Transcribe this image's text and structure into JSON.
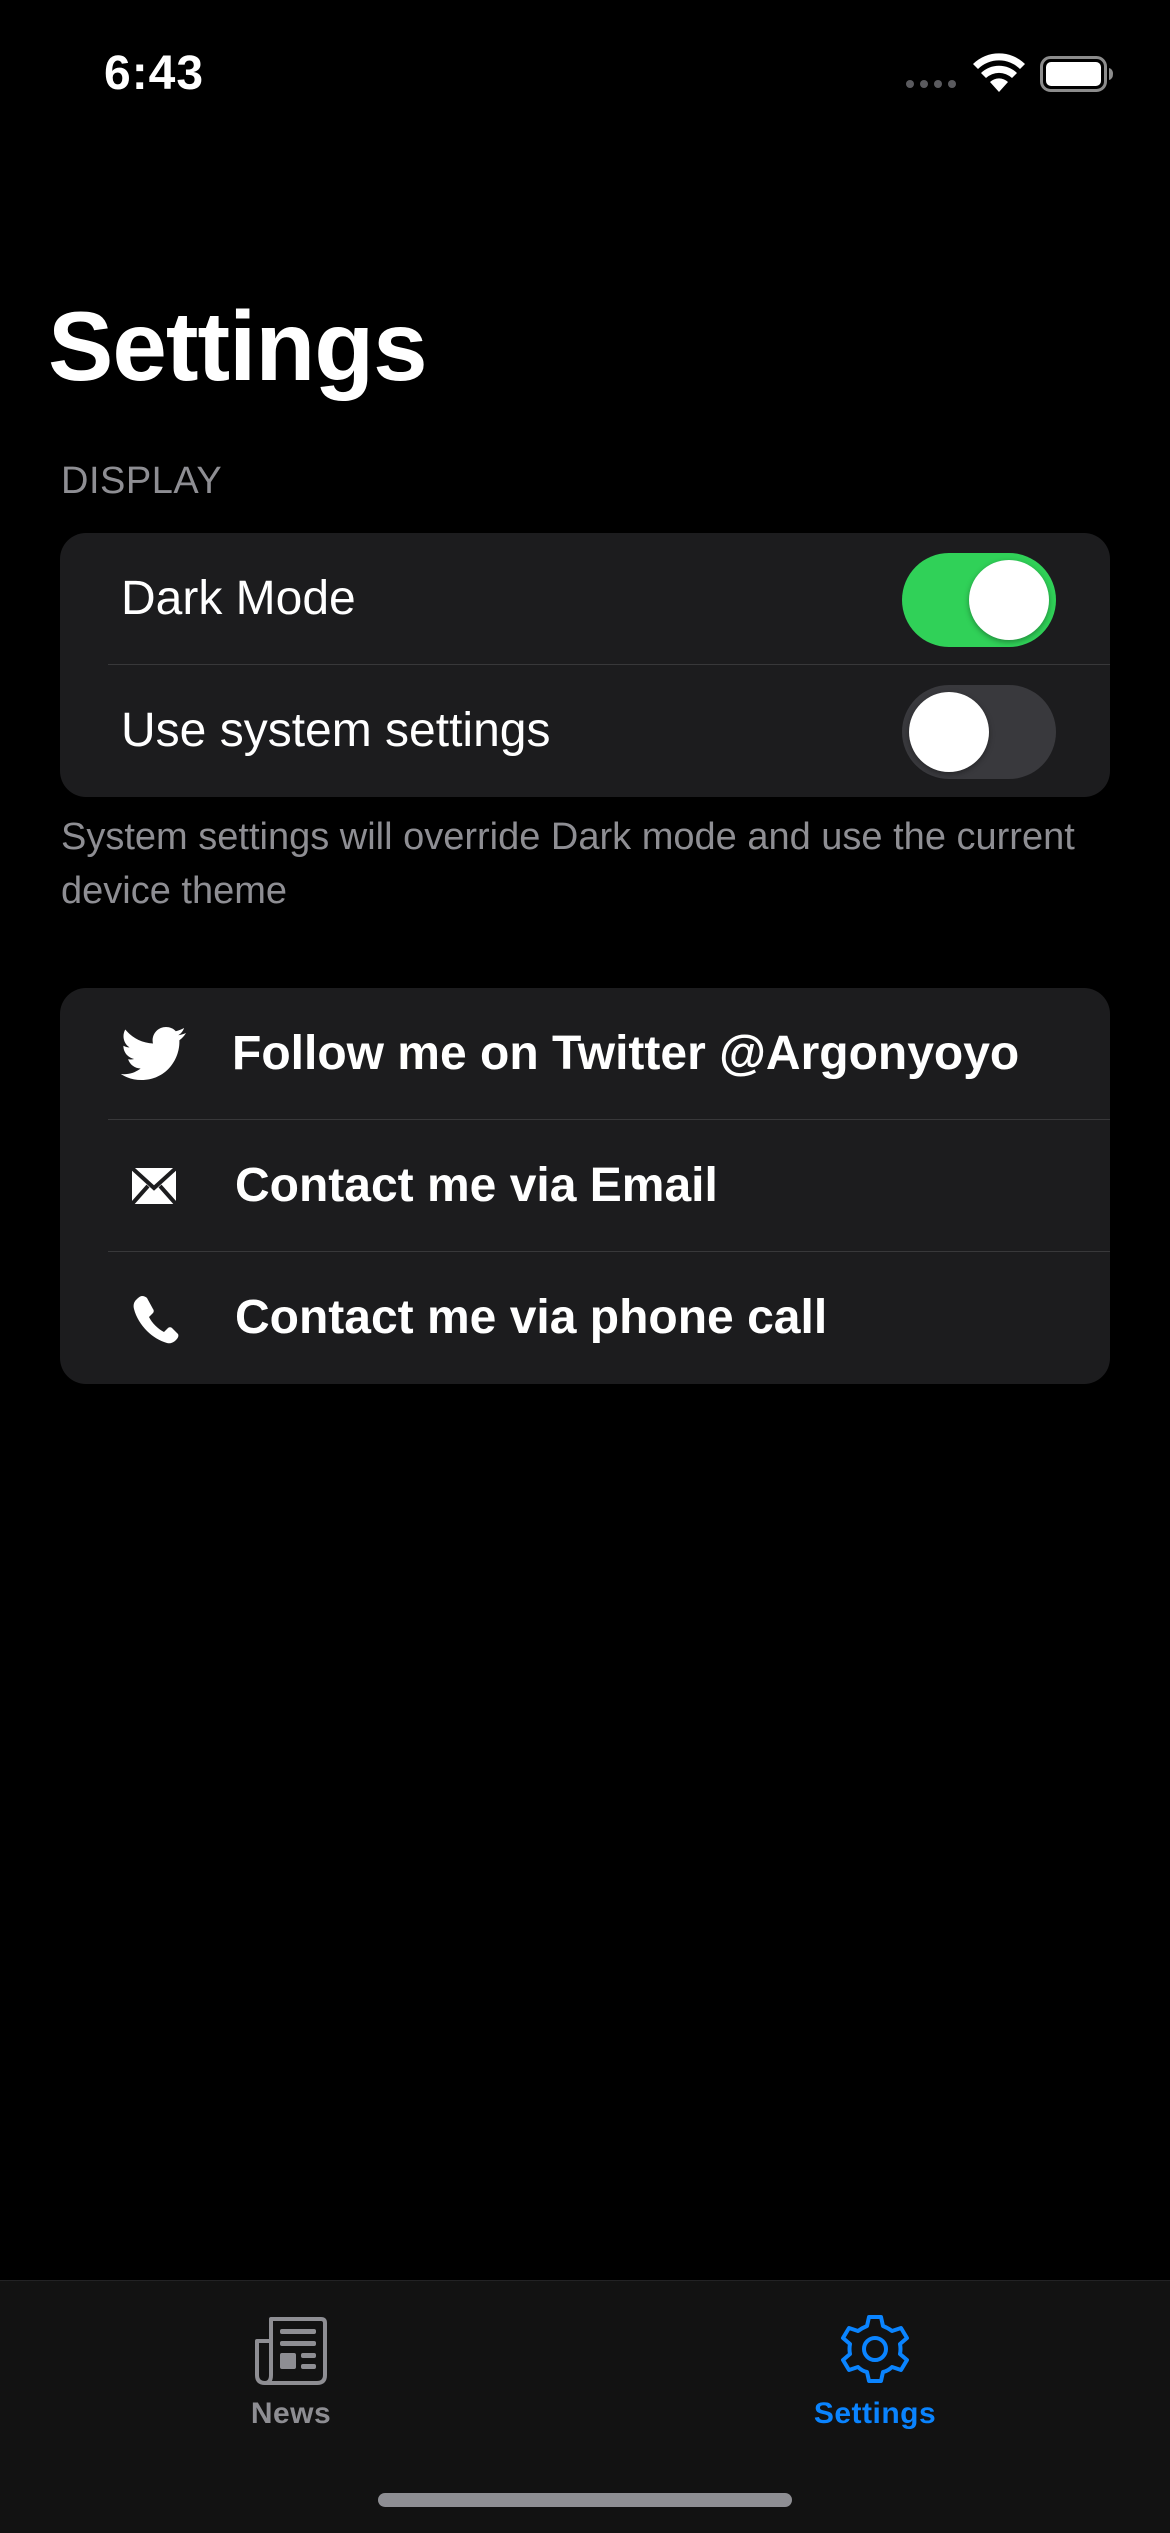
{
  "status_bar": {
    "time": "6:43"
  },
  "page": {
    "title": "Settings"
  },
  "display_section": {
    "header": "DISPLAY",
    "rows": [
      {
        "label": "Dark Mode",
        "toggle_on": true
      },
      {
        "label": "Use system settings",
        "toggle_on": false
      }
    ],
    "footer": "System settings will override Dark mode and use the current device theme"
  },
  "contact_section": {
    "rows": [
      {
        "label": "Follow me on Twitter @Argonyoyo",
        "icon": "twitter-bird-icon"
      },
      {
        "label": "Contact me via Email",
        "icon": "envelope-icon"
      },
      {
        "label": "Contact me via phone call",
        "icon": "phone-icon"
      }
    ]
  },
  "tab_bar": {
    "tabs": [
      {
        "label": "News",
        "icon": "newspaper-icon",
        "selected": false
      },
      {
        "label": "Settings",
        "icon": "gear-icon",
        "selected": true
      }
    ]
  },
  "colors": {
    "background": "#000000",
    "group_background": "#1c1c1e",
    "toggle_on": "#30d158",
    "toggle_off": "#39393d",
    "accent": "#0a84ff",
    "secondary_text": "#8e8e93"
  }
}
